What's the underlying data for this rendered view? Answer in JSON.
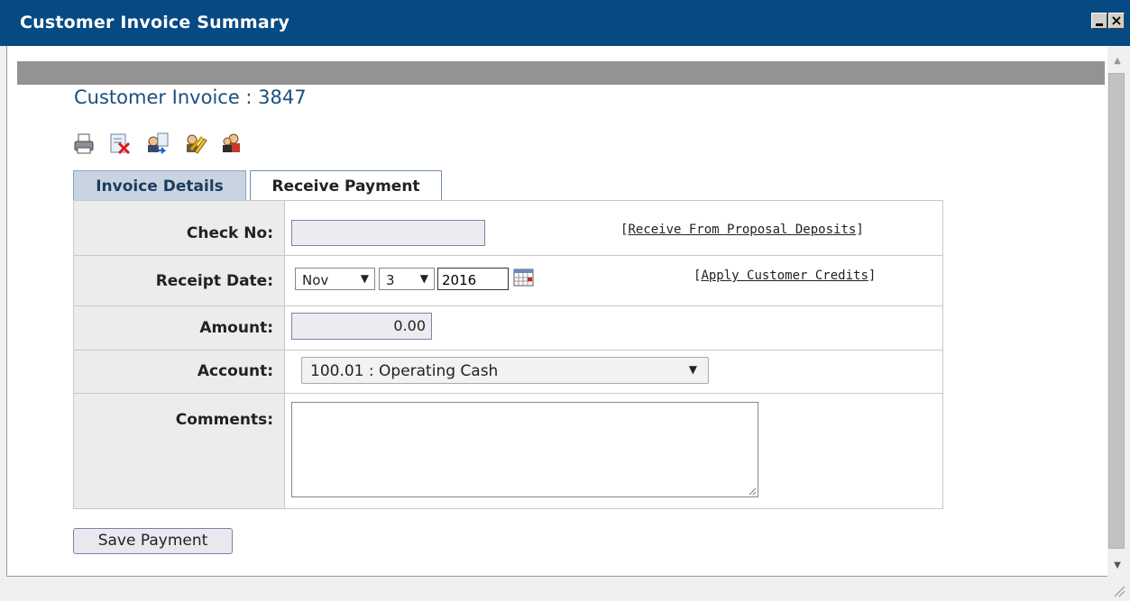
{
  "window": {
    "title": "Customer Invoice Summary"
  },
  "page": {
    "title": "Customer Invoice : 3847"
  },
  "toolbar": {
    "icons": [
      "print-icon",
      "delete-invoice-icon",
      "send-invoice-icon",
      "edit-icon",
      "users-icon"
    ]
  },
  "tabs": [
    {
      "label": "Invoice Details",
      "active": false
    },
    {
      "label": "Receive Payment",
      "active": true
    }
  ],
  "form": {
    "check_no_label": "Check No:",
    "check_no_value": "",
    "receipt_date_label": "Receipt Date:",
    "month": "Nov",
    "day": "3",
    "year": "2016",
    "amount_label": "Amount:",
    "amount_value": "0.00",
    "account_label": "Account:",
    "account_value": "100.01 : Operating Cash",
    "comments_label": "Comments:",
    "comments_value": ""
  },
  "links": {
    "deposits": "Receive From Proposal Deposits",
    "credits": "Apply Customer Credits"
  },
  "buttons": {
    "save": "Save Payment"
  },
  "colors": {
    "titlebar": "#064a84",
    "title_text": "#1a4f7e",
    "tab_inactive": "#c9d4e2"
  }
}
